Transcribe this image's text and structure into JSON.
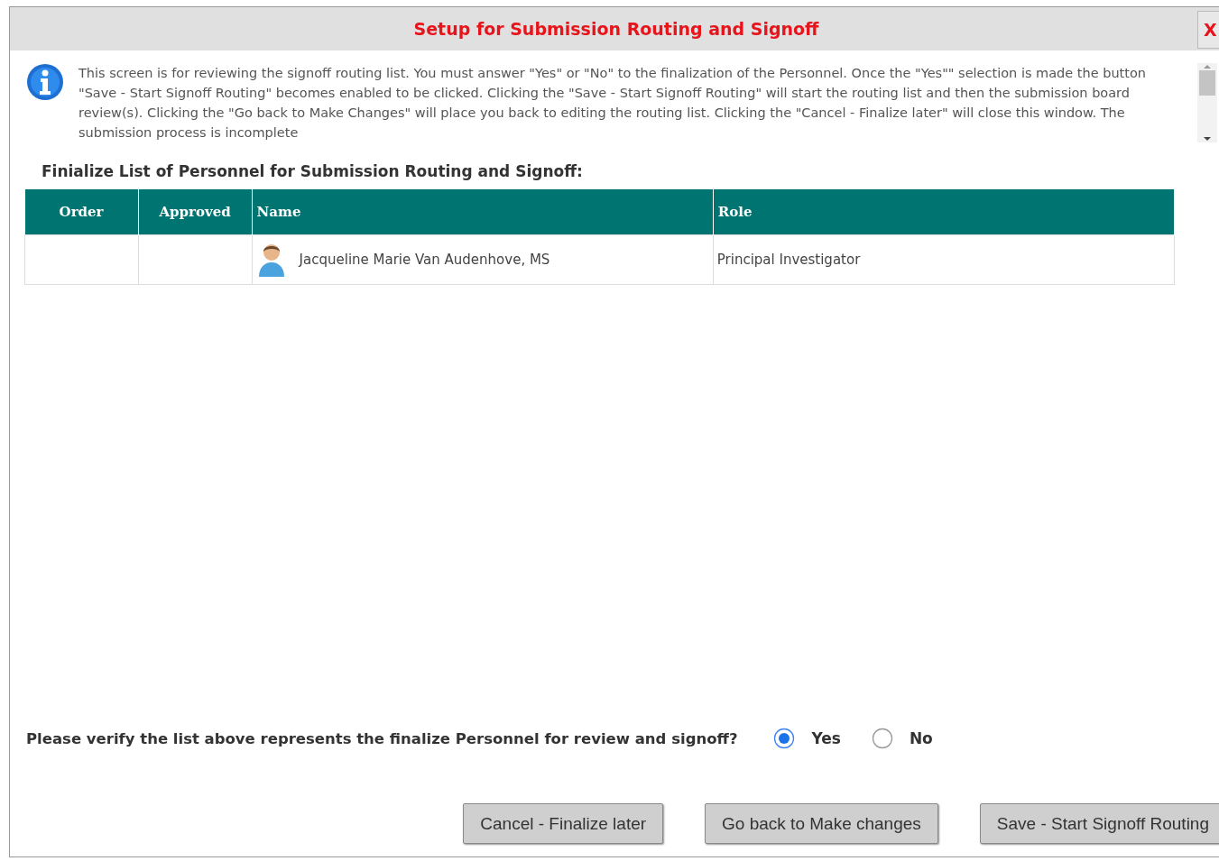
{
  "window": {
    "title": "Setup for Submission Routing and Signoff",
    "close": "X"
  },
  "info": "This screen is for reviewing the signoff routing list. You must answer \"Yes\" or \"No\" to the finalization of the Personnel. Once the \"Yes\"\" selection is made the button \"Save - Start Signoff Routing\" becomes enabled to be clicked. Clicking the \"Save - Start Signoff Routing\" will start the routing list and then the submission board review(s). Clicking the \"Go back to Make Changes\" will place you back to editing the routing list. Clicking the \"Cancel - Finalize later\" will close this window. The submission process is incomplete",
  "heading": "Finialize List of Personnel for Submission Routing and Signoff:",
  "table": {
    "columns": [
      "Order",
      "Approved",
      "Name",
      "Role"
    ],
    "rows": [
      {
        "name": "Jacqueline Marie Van Audenhove, MS",
        "role": "Principal Investigator"
      }
    ]
  },
  "question": "Please verify the list above represents the finalize Personnel for review and signoff?",
  "options": [
    {
      "label": "Yes",
      "selected": true
    },
    {
      "label": "No",
      "selected": false
    }
  ],
  "buttons": [
    "Cancel - Finalize later",
    "Go back to Make changes",
    "Save - Start Signoff Routing"
  ]
}
